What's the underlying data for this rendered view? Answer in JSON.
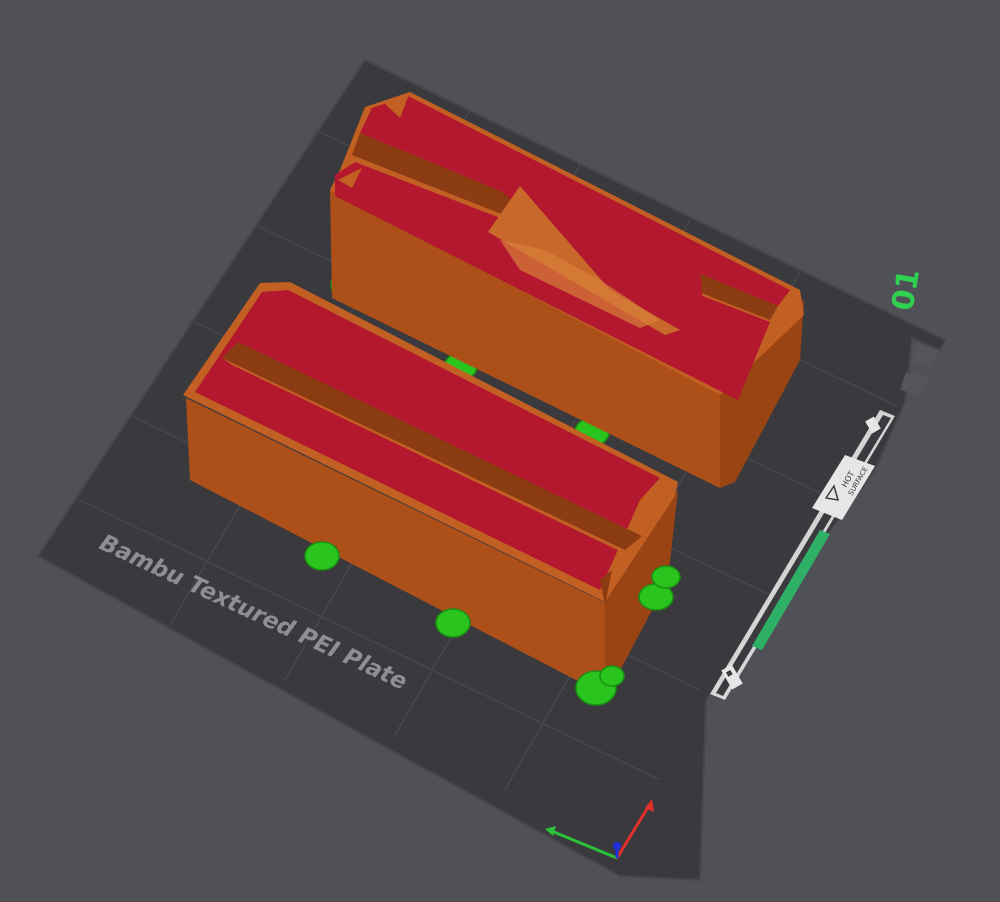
{
  "scene": {
    "plate_label": "Bambu Textured PEI Plate",
    "plate_number": "01",
    "plate_side_label_line1": "HOT",
    "plate_side_label_line2": "SURFACE"
  },
  "colors": {
    "background": "#505057",
    "plate": "#3a3a3e",
    "model_side": "#b4531a",
    "model_top": "#b3182e",
    "supports": "#29c41e",
    "plate_number": "#2fd24f",
    "axis_x": "#e0312c",
    "axis_y": "#2bc23a",
    "axis_z": "#2530d8"
  },
  "icons": {
    "axis_gizmo": "xyz-axis-icon",
    "plate_qr": "qr-code-icon",
    "plate_warning": "warning-triangle-icon"
  }
}
